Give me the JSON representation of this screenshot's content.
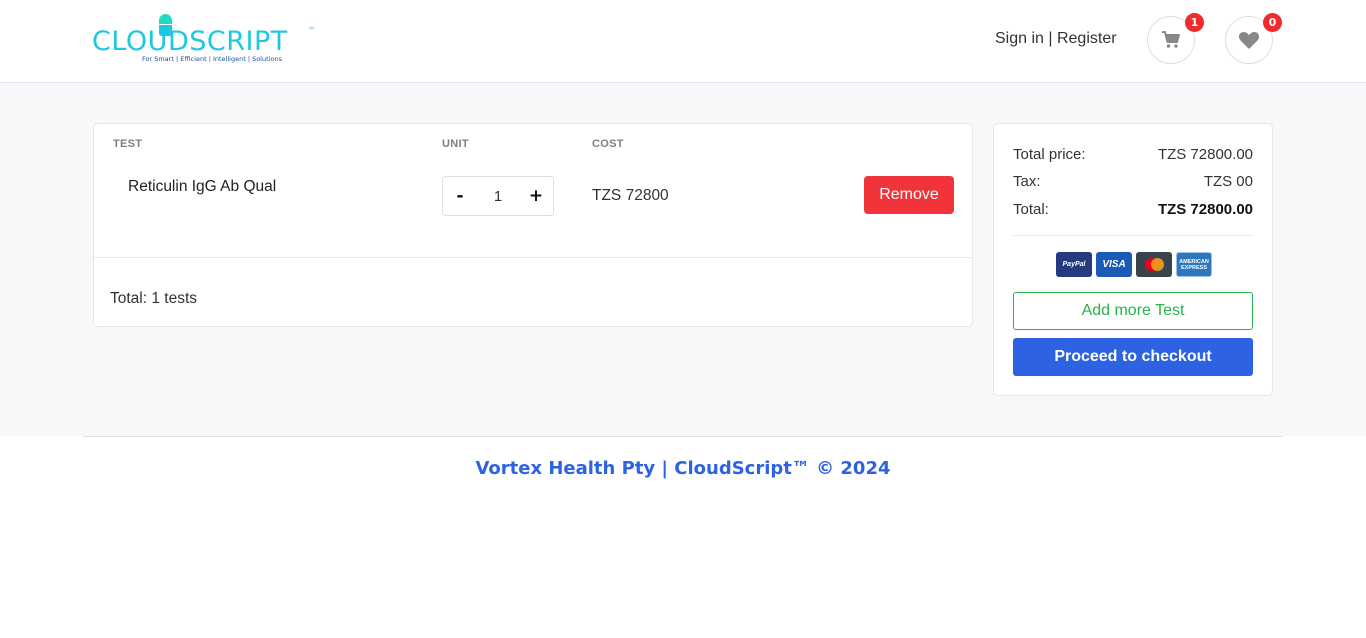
{
  "brand": {
    "name": "CLOUDSCRIPT",
    "trademark": "™",
    "tagline": "For Smart | Efficient | Intelligent | Solutions",
    "color": "#1fc8e0"
  },
  "header": {
    "sign_in": "Sign in",
    "separator": " | ",
    "register": "Register",
    "cart_count": "1",
    "wishlist_count": "0"
  },
  "cart": {
    "columns": {
      "test": "TEST",
      "unit": "UNIT",
      "cost": "COST"
    },
    "items": [
      {
        "name": "Reticulin IgG Ab Qual",
        "quantity": "1",
        "cost": "TZS 72800",
        "remove_label": "Remove",
        "minus": "-",
        "plus": "+"
      }
    ],
    "total_text": "Total: 1 tests"
  },
  "summary": {
    "total_price_label": "Total price:",
    "total_price_value": "TZS 72800.00",
    "tax_label": "Tax:",
    "tax_value": "TZS 00",
    "total_label": "Total:",
    "total_value": "TZS 72800.00",
    "payment_methods": [
      "PayPal",
      "VISA",
      "Mastercard",
      "AMERICAN EXPRESS"
    ],
    "add_more_label": "Add more Test",
    "checkout_label": "Proceed to checkout"
  },
  "footer": {
    "text": "Vortex Health Pty | CloudScript™ © 2024"
  },
  "colors": {
    "accent": "#2d63e2",
    "danger": "#f1343a",
    "success": "#2bb24c",
    "badge": "#ef2b2d"
  }
}
